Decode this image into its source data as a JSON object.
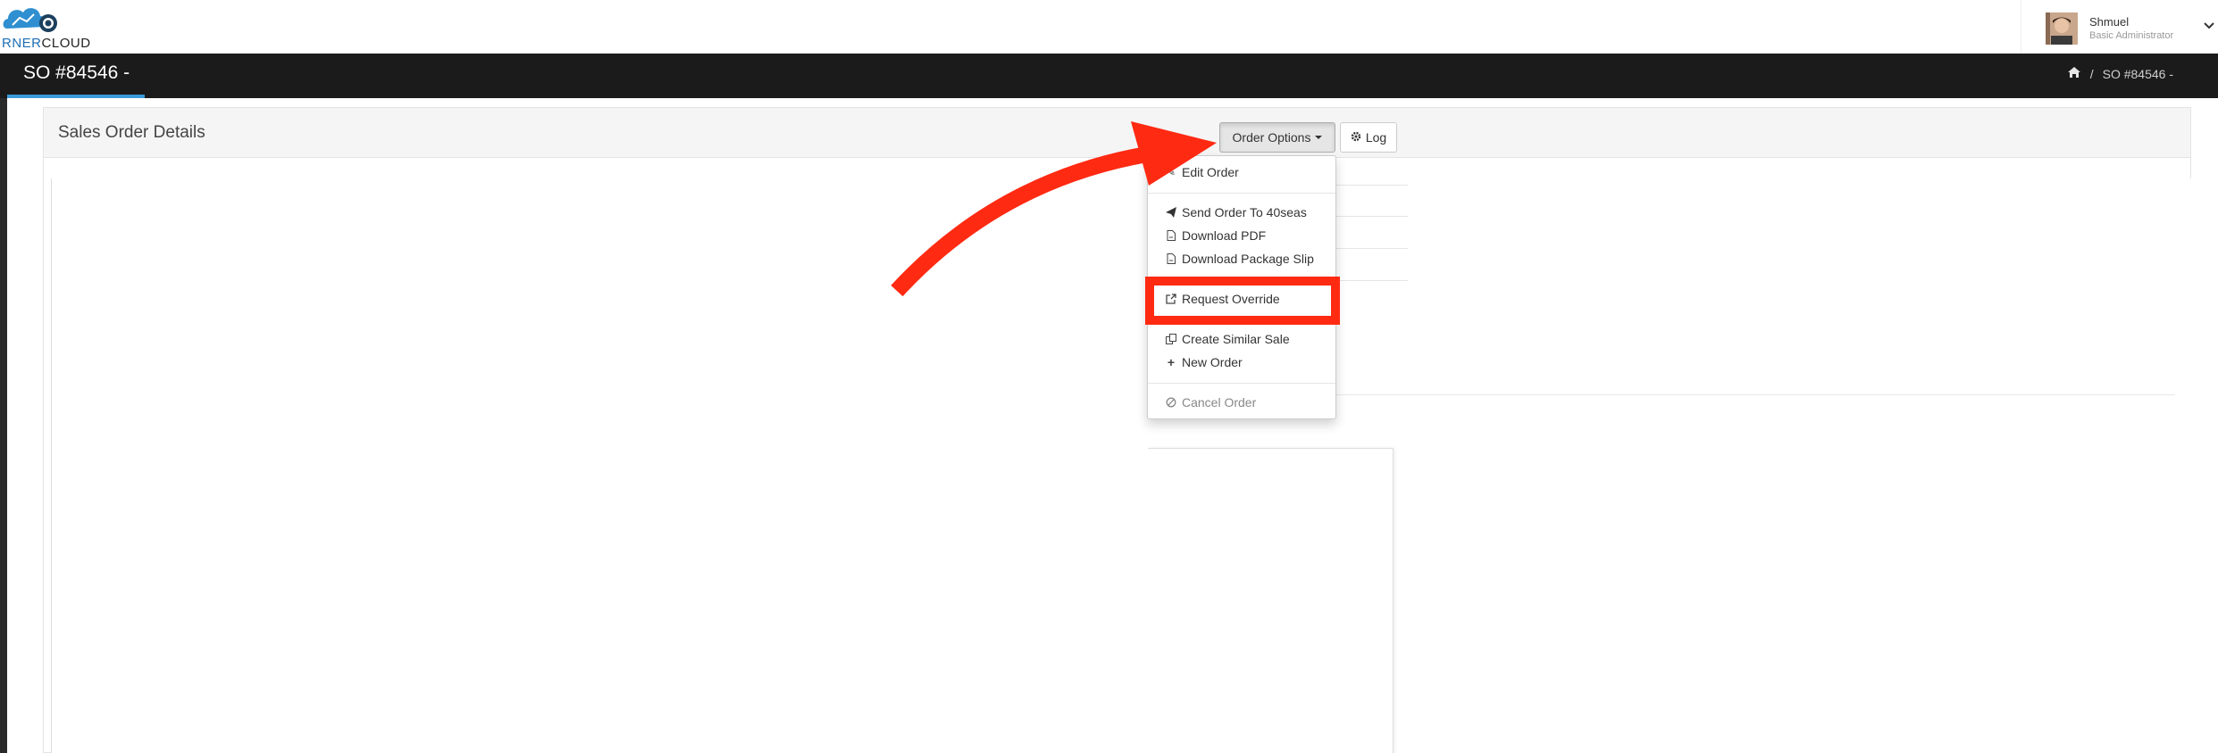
{
  "header": {
    "logo": {
      "text_colored": "RNER",
      "text_dark": "CLOUD"
    },
    "user": {
      "name": "Shmuel",
      "role": "Basic Administrator"
    }
  },
  "titlebar": {
    "title": "SO #84546 -",
    "breadcrumb": {
      "separator": "/",
      "current": "SO #84546 -"
    }
  },
  "panel": {
    "title": "Sales Order Details",
    "buttons": {
      "order_options": "Order Options",
      "log": "Log"
    }
  },
  "dropdown": {
    "items": [
      {
        "label": "Edit Order",
        "icon": "pencil-icon"
      },
      {
        "label": "Send Order To 40seas",
        "icon": "paper-plane-icon"
      },
      {
        "label": "Download PDF",
        "icon": "file-pdf-icon"
      },
      {
        "label": "Download Package Slip",
        "icon": "file-pdf-icon"
      },
      {
        "label": "Request Override",
        "icon": "external-link-icon"
      },
      {
        "label": "Create Similar Sale",
        "icon": "copy-icon"
      },
      {
        "label": "New Order",
        "icon": "plus-icon"
      },
      {
        "label": "Cancel Order",
        "icon": "ban-icon",
        "disabled": true
      }
    ]
  },
  "annotation": {
    "color": "#ff2a12"
  },
  "colors": {
    "titlebar": "#1b1b1b",
    "accent": "#3a9ad9",
    "annotation": "#ff2a12"
  }
}
